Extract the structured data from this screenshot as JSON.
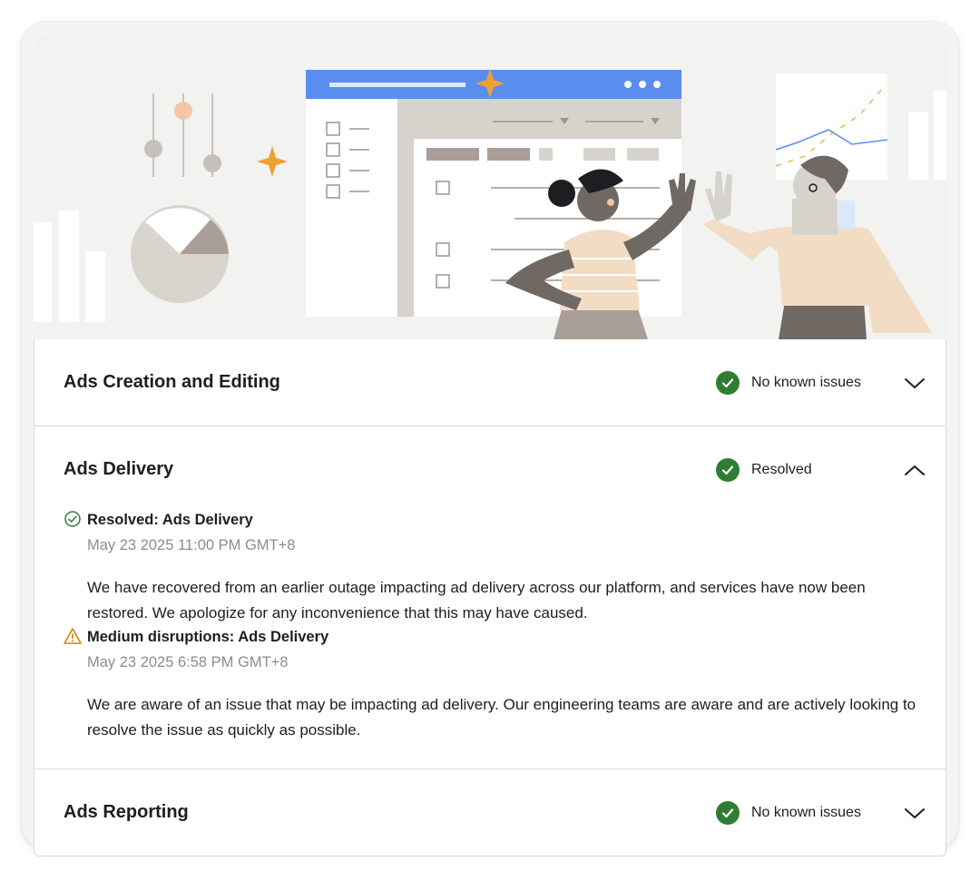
{
  "hero": {
    "illustration": "two people high-fiving in front of a dashboard window"
  },
  "sections": [
    {
      "title": "Ads Creation and Editing",
      "status": "No known issues",
      "status_icon": "check-circle-icon",
      "expanded": false
    },
    {
      "title": "Ads Delivery",
      "status": "Resolved",
      "status_icon": "check-circle-icon",
      "expanded": true,
      "updates": [
        {
          "icon": "check-circle-outline-icon",
          "title": "Resolved: Ads Delivery",
          "time": "May 23 2025 11:00 PM GMT+8",
          "body": "We have recovered from an earlier outage impacting ad delivery across our platform, and services have now been restored. We apologize for any inconvenience that this may have caused."
        },
        {
          "icon": "warning-triangle-icon",
          "title": "Medium disruptions: Ads Delivery",
          "time": "May 23 2025 6:58 PM GMT+8",
          "body": "We are aware of an issue that may be impacting ad delivery. Our engineering teams are aware and are actively looking to resolve the issue as quickly as possible."
        }
      ]
    },
    {
      "title": "Ads Reporting",
      "status": "No known issues",
      "status_icon": "check-circle-icon",
      "expanded": false
    }
  ],
  "colors": {
    "success": "#2e7d32",
    "warning": "#e07b00",
    "accent": "#5b8def",
    "star": "#f0a030"
  }
}
